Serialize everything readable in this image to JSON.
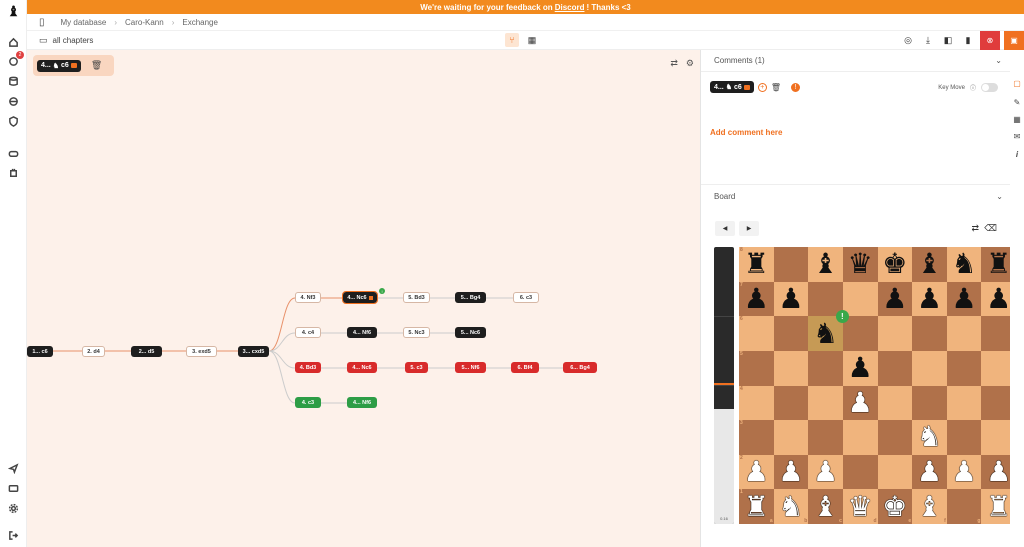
{
  "banner": {
    "text_before": "We're waiting for your feedback on",
    "link": "Discord",
    "text_after": "! Thanks <3"
  },
  "breadcrumb": [
    "My database",
    "Caro-Kann",
    "Exchange"
  ],
  "toolbar": {
    "chapters_label": "all chapters"
  },
  "sidebar": {
    "notifications_count": "2"
  },
  "current_move": {
    "number": "4...",
    "san": "c6"
  },
  "tree": {
    "nodes": [
      {
        "label": "1... c6",
        "style": "black"
      },
      {
        "label": "2. d4",
        "style": "white"
      },
      {
        "label": "2... d5",
        "style": "black"
      },
      {
        "label": "3. exd5",
        "style": "white"
      },
      {
        "label": "3... cxd5",
        "style": "black"
      },
      {
        "label": "4. Nf3",
        "style": "white"
      },
      {
        "label": "4... Nc6",
        "style": "black"
      },
      {
        "label": "5. Bd3",
        "style": "white"
      },
      {
        "label": "5... Bg4",
        "style": "black"
      },
      {
        "label": "6. c3",
        "style": "white"
      },
      {
        "label": "4. c4",
        "style": "white"
      },
      {
        "label": "4... Nf6",
        "style": "black"
      },
      {
        "label": "5. Nc3",
        "style": "white"
      },
      {
        "label": "5... Nc6",
        "style": "black"
      },
      {
        "label": "4. Bd3",
        "style": "red"
      },
      {
        "label": "4... Nc6",
        "style": "red"
      },
      {
        "label": "5. c3",
        "style": "red"
      },
      {
        "label": "5... Nf6",
        "style": "red"
      },
      {
        "label": "6. Bf4",
        "style": "red"
      },
      {
        "label": "6... Bg4",
        "style": "red"
      },
      {
        "label": "4. c3",
        "style": "green"
      },
      {
        "label": "4... Nf6",
        "style": "green"
      }
    ]
  },
  "comments": {
    "title": "Comments (1)",
    "move_number": "4...",
    "move_san": "c6",
    "key_move_label": "Key Move",
    "add_comment": "Add comment here"
  },
  "board": {
    "title": "Board",
    "eval": "0.16",
    "ranks": [
      "8",
      "7",
      "6",
      "5",
      "4",
      "3",
      "2",
      "1"
    ],
    "files": [
      "a",
      "b",
      "c",
      "d",
      "e",
      "f",
      "g",
      "h"
    ],
    "position": [
      [
        "r",
        "",
        "b",
        "q",
        "k",
        "b",
        "n",
        "r"
      ],
      [
        "p",
        "p",
        "",
        "",
        "p",
        "p",
        "p",
        "p"
      ],
      [
        "",
        "",
        "n",
        "",
        "",
        "",
        "",
        ""
      ],
      [
        "",
        "",
        "",
        "p",
        "",
        "",
        "",
        ""
      ],
      [
        "",
        "",
        "",
        "P",
        "",
        "",
        "",
        ""
      ],
      [
        "",
        "",
        "",
        "",
        "",
        "N",
        "",
        ""
      ],
      [
        "P",
        "P",
        "P",
        "",
        "",
        "P",
        "P",
        "P"
      ],
      [
        "R",
        "N",
        "B",
        "Q",
        "K",
        "B",
        "",
        "R"
      ]
    ],
    "highlight": [
      "c6"
    ],
    "annotation": {
      "square": "c6",
      "symbol": "!"
    }
  }
}
